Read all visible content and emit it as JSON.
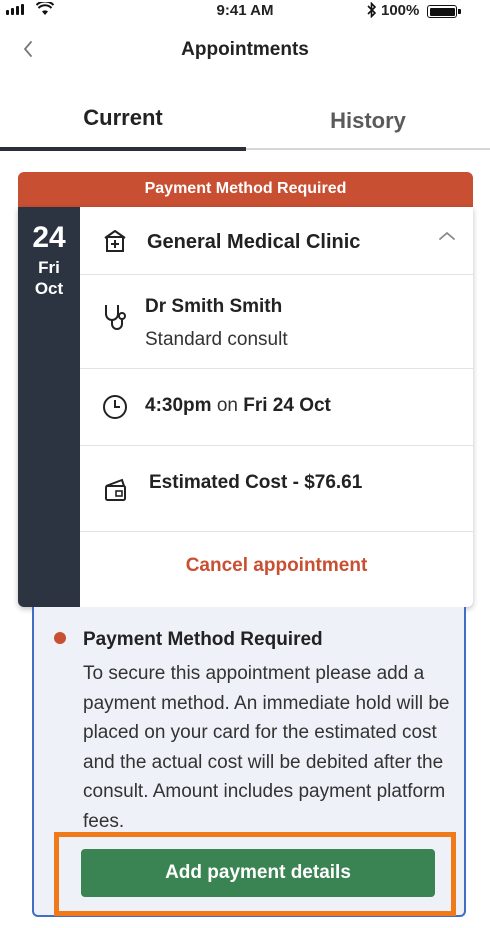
{
  "status_bar": {
    "time": "9:41 AM",
    "battery": "100%"
  },
  "nav": {
    "title": "Appointments",
    "back_icon": "chevron-left-icon"
  },
  "tabs": [
    {
      "label": "Current",
      "active": true
    },
    {
      "label": "History",
      "active": false
    }
  ],
  "appointment": {
    "banner": "Payment Method Required",
    "date": {
      "day": "24",
      "weekday": "Fri",
      "month": "Oct"
    },
    "clinic": "General Medical Clinic",
    "doctor": "Dr Smith Smith",
    "consult_type": "Standard consult",
    "time": {
      "value": "4:30pm",
      "connector": "on",
      "date": "Fri 24 Oct"
    },
    "cost": "Estimated Cost - $76.61",
    "cancel_label": "Cancel appointment"
  },
  "payment_notice": {
    "title": "Payment Method Required",
    "body": "To secure this appointment please add a payment method. An immediate hold will be placed on your card for the estimated cost and the actual cost will be debited after the consult. Amount includes payment platform fees.",
    "button_label": "Add payment details"
  },
  "colors": {
    "banner": "#c94f33",
    "date_column": "#2c3442",
    "button": "#3a8352",
    "info_border": "#3f6ec4",
    "highlight": "#f07a1a"
  }
}
